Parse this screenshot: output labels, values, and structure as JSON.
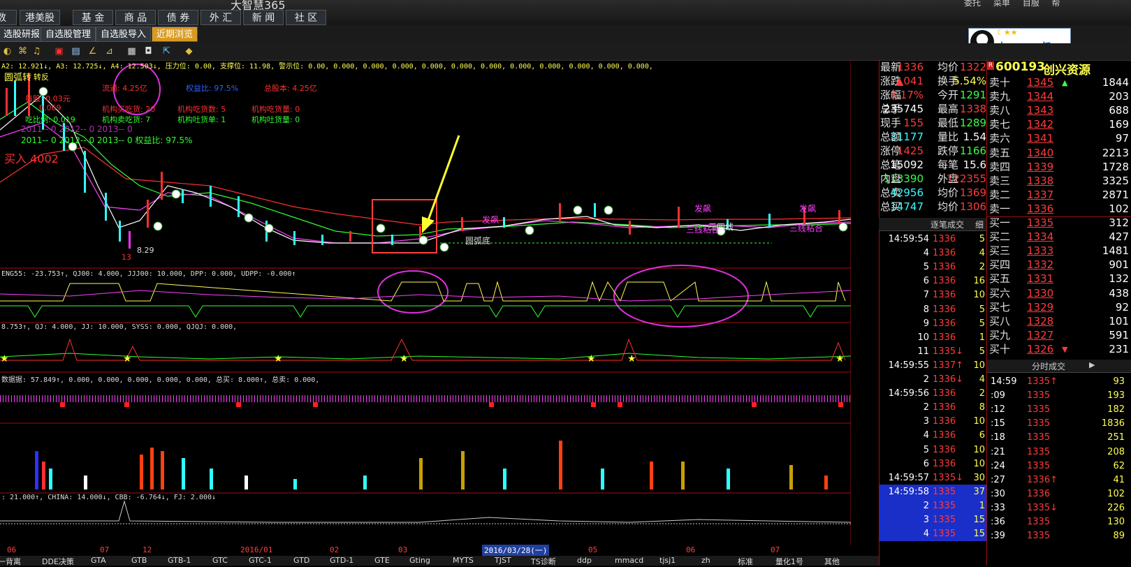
{
  "app": {
    "title": "大智慧365"
  },
  "top_menu": [
    "数",
    "港美股",
    "基 金",
    "商 品",
    "债 券",
    "外 汇",
    "新 闻",
    "社 区"
  ],
  "top_right": [
    "委托",
    "菜单",
    "自服",
    "帮"
  ],
  "sub_menu": [
    "选股研报",
    "自选股管理",
    "自选股导入",
    "近期浏览"
  ],
  "qq_widget": {
    "text": "中 ♪ ·· ✎ 旨"
  },
  "main_indicator": {
    "line1": "A2: 12.921↓, A3: 12.725↓, A4: 12.503↓, 压力位: 0.00, 支撑位: 11.98, 警示位: 0.00, 0.000, 0.000, 0.000, 0.000, 0.000, 0.000, 0.000, 0.000, 0.000, 0.000, 0.000,",
    "info_a": "流通: 4.25亿",
    "info_b": "权益比: 97.5%",
    "info_c": "总股本: 4.25亿",
    "info_d": "每股: 0.03元",
    "info_e": "机构买吃货: 20",
    "info_f": "机构吃货数: 5",
    "info_g": "机构吃货量: 0",
    "info_h": "0.069",
    "info_i": "吃比例: 0.019",
    "info_j": "机构卖吃货: 7",
    "info_k": "机构吐货单: 1",
    "info_l": "机构吐货量: 0",
    "years1": "2011-- 0    2012-- 0    2013-- 0",
    "years2": "2011-- 0    2012-- 0    2013-- 0    权益比: 97.5%",
    "buy_label": "买入 4002",
    "label_turn": "圆弧转",
    "label_turn2": "转反",
    "low_price": "8.29",
    "num13": "13",
    "arc_bottom": "圆弧底",
    "labels_fa": "发飙",
    "labels_line": "三线粘合",
    "label_four": "三四线"
  },
  "indicator2": "ENG55: -23.753↑, QJ00: 4.000, JJJ00: 10.000, DPP: 0.000, UDPP: -0.000↑",
  "indicator3": "8.753↑, QJ: 4.000, JJ: 10.000, SYSS: 0.000, QJQJ: 0.000,",
  "indicator4": "数据据: 57.849↑, 0.000, 0.000, 0.000, 0.000, 0.000, 总买: 8.000↑, 总卖: 0.000,",
  "indicator5": ": 21.000↑, CHINA: 14.000↓, CBB: -6.764↓, FJ: 2.000↓",
  "date_bar": {
    "ticks": [
      "06",
      "07",
      "12",
      "2016/01",
      "02",
      "03",
      "05",
      "06",
      "07"
    ],
    "highlight": "2016/03/28(一)"
  },
  "bottom_tabs": [
    "5一背离",
    "DDE决策",
    "GTA",
    "GTB",
    "GTB-1",
    "GTC",
    "GTC-1",
    "GTD",
    "GTD-1",
    "GTE",
    "Gting",
    "MYTS",
    "TJST",
    "TS诊断",
    "ddp",
    "mmacd",
    "tjsj1",
    "zh",
    "标准",
    "量化1号",
    "其他"
  ],
  "stock": {
    "code": "600193",
    "name": "创兴资源",
    "badge": "R"
  },
  "quote_left": [
    {
      "l1": "最新",
      "v1": "1336",
      "c1": "up",
      "l2": "均价",
      "v2": "1322",
      "c2": "up"
    },
    {
      "l1": "涨跌",
      "v1": "▲041",
      "c1": "up",
      "l2": "换手",
      "v2": "5.54%",
      "c2": "yl"
    },
    {
      "l1": "涨幅",
      "v1": "3.17%",
      "c1": "up",
      "l2": "今开",
      "v2": "1291",
      "c2": "dn"
    },
    {
      "l1": "总手",
      "v1": "235745",
      "c1": "wh",
      "l2": "最高",
      "v2": "1338",
      "c2": "up"
    },
    {
      "l1": "现手",
      "v1": "155",
      "c1": "up",
      "l2": "最低",
      "v2": "1289",
      "c2": "dn"
    },
    {
      "l1": "总额",
      "v1": "31177",
      "c1": "cy",
      "l2": "量比",
      "v2": "1.54",
      "c2": "wh"
    },
    {
      "l1": "涨停",
      "v1": "1425",
      "c1": "up",
      "l2": "跌停",
      "v2": "1166",
      "c2": "dn"
    },
    {
      "l1": "总笔",
      "v1": "15092",
      "c1": "wh",
      "l2": "每笔",
      "v2": "15.6",
      "c2": "wh"
    },
    {
      "l1": "内盘",
      "v1": "113390",
      "c1": "dn",
      "l2": "外盘",
      "v2": "122355",
      "c2": "up"
    },
    {
      "l1": "总卖",
      "v1": "42956",
      "c1": "cy",
      "l2": "均价",
      "v2": "1369",
      "c2": "up"
    },
    {
      "l1": "总买",
      "v1": "14747",
      "c1": "cy",
      "l2": "均价",
      "v2": "1306",
      "c2": "up"
    }
  ],
  "order_book": [
    {
      "l": "卖十",
      "p": "1345",
      "v": "1844",
      "arrow": "▲"
    },
    {
      "l": "卖九",
      "p": "1344",
      "v": "203",
      "arrow": ""
    },
    {
      "l": "卖八",
      "p": "1343",
      "v": "688",
      "arrow": ""
    },
    {
      "l": "卖七",
      "p": "1342",
      "v": "169",
      "arrow": ""
    },
    {
      "l": "卖六",
      "p": "1341",
      "v": "97",
      "arrow": ""
    },
    {
      "l": "卖五",
      "p": "1340",
      "v": "2213",
      "arrow": ""
    },
    {
      "l": "卖四",
      "p": "1339",
      "v": "1728",
      "arrow": ""
    },
    {
      "l": "卖三",
      "p": "1338",
      "v": "3325",
      "arrow": ""
    },
    {
      "l": "卖二",
      "p": "1337",
      "v": "2871",
      "arrow": ""
    },
    {
      "l": "卖一",
      "p": "1336",
      "v": "102",
      "arrow": ""
    },
    {
      "l": "买一",
      "p": "1335",
      "v": "312",
      "arrow": ""
    },
    {
      "l": "买二",
      "p": "1334",
      "v": "427",
      "arrow": ""
    },
    {
      "l": "买三",
      "p": "1333",
      "v": "1481",
      "arrow": ""
    },
    {
      "l": "买四",
      "p": "1332",
      "v": "901",
      "arrow": ""
    },
    {
      "l": "买五",
      "p": "1331",
      "v": "132",
      "arrow": ""
    },
    {
      "l": "买六",
      "p": "1330",
      "v": "438",
      "arrow": ""
    },
    {
      "l": "买七",
      "p": "1329",
      "v": "92",
      "arrow": ""
    },
    {
      "l": "买八",
      "p": "1328",
      "v": "101",
      "arrow": ""
    },
    {
      "l": "买九",
      "p": "1327",
      "v": "591",
      "arrow": ""
    },
    {
      "l": "买十",
      "p": "1326",
      "v": "231",
      "arrow": "▼"
    }
  ],
  "tick_header": "逐笔成交",
  "tick_btn": "细",
  "ticks": [
    {
      "t": "14:59:54",
      "p": "1336",
      "v": "5",
      "hl": false
    },
    {
      "t": "4",
      "p": "1336",
      "v": "4",
      "hl": false
    },
    {
      "t": "5",
      "p": "1336",
      "v": "2",
      "hl": false
    },
    {
      "t": "6",
      "p": "1336",
      "v": "16",
      "hl": false
    },
    {
      "t": "7",
      "p": "1336",
      "v": "10",
      "hl": false
    },
    {
      "t": "8",
      "p": "1336",
      "v": "5",
      "hl": false
    },
    {
      "t": "9",
      "p": "1336",
      "v": "5",
      "hl": false
    },
    {
      "t": "10",
      "p": "1336",
      "v": "1",
      "hl": false
    },
    {
      "t": "11",
      "p": "1335↓",
      "v": "5",
      "hl": false
    },
    {
      "t": "14:59:55",
      "p": "1337↑",
      "v": "10",
      "hl": false
    },
    {
      "t": "2",
      "p": "1336↓",
      "v": "4",
      "hl": false
    },
    {
      "t": "14:59:56",
      "p": "1336",
      "v": "2",
      "hl": false
    },
    {
      "t": "2",
      "p": "1336",
      "v": "8",
      "hl": false
    },
    {
      "t": "3",
      "p": "1336",
      "v": "10",
      "hl": false
    },
    {
      "t": "4",
      "p": "1336",
      "v": "6",
      "hl": false
    },
    {
      "t": "5",
      "p": "1336",
      "v": "10",
      "hl": false
    },
    {
      "t": "6",
      "p": "1336",
      "v": "10",
      "hl": false
    },
    {
      "t": "14:59:57",
      "p": "1335↓",
      "v": "30",
      "hl": false
    },
    {
      "t": "14:59:58",
      "p": "1335",
      "v": "37",
      "hl": true
    },
    {
      "t": "2",
      "p": "1335",
      "v": "1",
      "hl": true
    },
    {
      "t": "3",
      "p": "1335",
      "v": "15",
      "hl": true
    },
    {
      "t": "4",
      "p": "1335",
      "v": "15",
      "hl": true
    }
  ],
  "minute_header": "分时成交",
  "minute_ticks": [
    {
      "t": "14:59",
      "p": "1335↑",
      "v": "93"
    },
    {
      "t": ":09",
      "p": "1335",
      "v": "193"
    },
    {
      "t": ":12",
      "p": "1335",
      "v": "182"
    },
    {
      "t": ":15",
      "p": "1335",
      "v": "1836"
    },
    {
      "t": ":18",
      "p": "1335",
      "v": "251"
    },
    {
      "t": ":21",
      "p": "1335",
      "v": "208"
    },
    {
      "t": ":24",
      "p": "1335",
      "v": "62"
    },
    {
      "t": ":27",
      "p": "1336↑",
      "v": "41"
    },
    {
      "t": ":30",
      "p": "1336",
      "v": "102"
    },
    {
      "t": ":33",
      "p": "1335↓",
      "v": "226"
    },
    {
      "t": ":36",
      "p": "1335",
      "v": "130"
    },
    {
      "t": ":39",
      "p": "1335",
      "v": "89"
    }
  ],
  "colors": {
    "up": "#ff3b3b",
    "down": "#3bff4a",
    "accent": "#d89a22",
    "magenta": "#ff33ff",
    "cyan": "#33ffff",
    "yellow": "#ffff40"
  }
}
